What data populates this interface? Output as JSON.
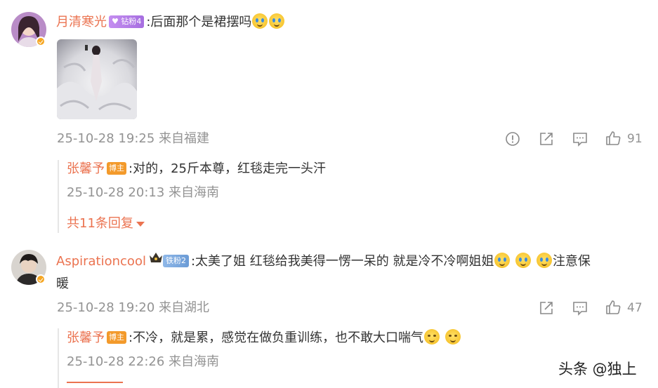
{
  "comments": [
    {
      "username": "月清寒光",
      "badge": "钻粉4",
      "text": ":后面那个是裙摆吗",
      "time": "25-10-28 19:25",
      "location": "来自福建",
      "likes": "91",
      "reply": {
        "username": "张馨予",
        "badge": "博主",
        "text": ":对的，25斤本尊，红毯走完一头汗",
        "time": "25-10-28 20:13",
        "location": "来自海南"
      },
      "more_replies": "共11条回复"
    },
    {
      "username": "Aspirationcool",
      "badge": "铁粉2",
      "text_line1": ":太美了姐 红毯给我美得一愣一呆的 就是冷不冷啊姐姐",
      "text_line1_tail": "注意保",
      "text_line2": "暖",
      "time": "25-10-28 19:20",
      "location": "来自湖北",
      "likes": "47",
      "reply": {
        "username": "张馨予",
        "badge": "博主",
        "text": ":不冷，就是累，感觉在做负重训练，也不敢大口喘气",
        "time": "25-10-28 22:26",
        "location": "来自海南"
      }
    }
  ],
  "watermark": "头条 @独上",
  "colors": {
    "username": "#eb7350",
    "meta": "#939393",
    "text": "#333333"
  }
}
